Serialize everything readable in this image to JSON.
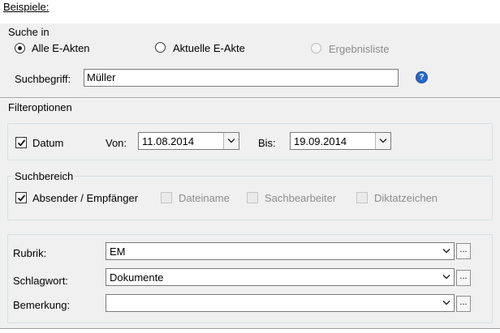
{
  "header": {
    "title": "Beispiele:"
  },
  "search_in": {
    "group_label": "Suche in",
    "options": [
      {
        "label": "Alle E-Akten",
        "checked": true,
        "disabled": false
      },
      {
        "label": "Aktuelle E-Akte",
        "checked": false,
        "disabled": false
      },
      {
        "label": "Ergebnisliste",
        "checked": false,
        "disabled": true
      }
    ],
    "term_label": "Suchbegriff:",
    "term_value": "Müller",
    "help_glyph": "?"
  },
  "filter": {
    "section_label": "Filteroptionen",
    "datum_label": "Datum",
    "datum_checked": true,
    "von_label": "Von:",
    "von_value": "11.08.2014",
    "bis_label": "Bis:",
    "bis_value": "19.09.2014"
  },
  "suchbereich": {
    "group_label": "Suchbereich",
    "items": [
      {
        "label": "Absender / Empfänger",
        "checked": true,
        "disabled": false
      },
      {
        "label": "Dateiname",
        "checked": false,
        "disabled": true
      },
      {
        "label": "Sachbearbeiter",
        "checked": false,
        "disabled": true
      },
      {
        "label": "Diktatzeichen",
        "checked": false,
        "disabled": true
      }
    ]
  },
  "fields": {
    "rubrik_label": "Rubrik:",
    "rubrik_value": "EM",
    "schlagwort_label": "Schlagwort:",
    "schlagwort_value": "Dokumente",
    "bemerkung_label": "Bemerkung:",
    "bemerkung_value": "",
    "browse_label": "..."
  },
  "icons": {
    "checkmark": "check-icon",
    "dropdown": "chevron-down-icon",
    "help": "help-icon"
  },
  "colors": {
    "panel_bg": "#f0f0f0",
    "help_blue": "#2a67c8"
  }
}
